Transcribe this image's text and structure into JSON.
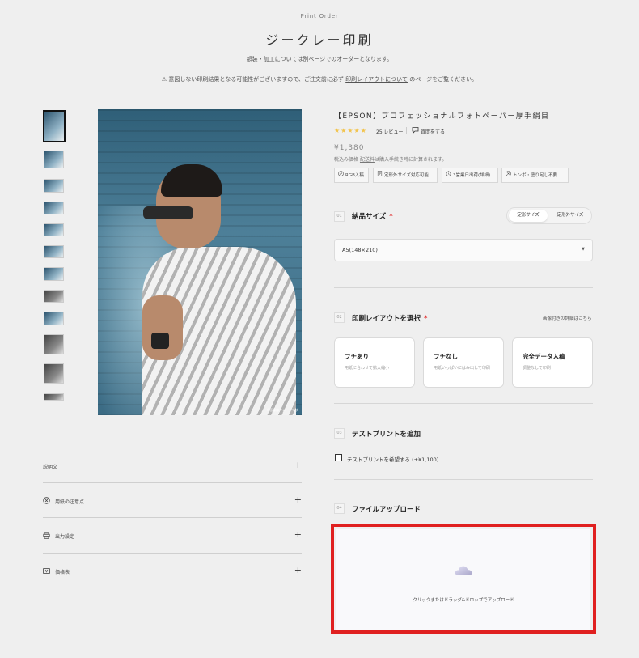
{
  "header": {
    "eyebrow": "Print Order",
    "title": "ジークレー印刷",
    "note1_link1": "額装",
    "note1_sep": "・",
    "note1_link2": "加工",
    "note1_rest": "については別ページでのオーダーとなります。",
    "note2_prefix": "⚠ 意図しない印刷結果となる可能性がございますので、ご注文前に必ず",
    "note2_link": "印刷レイアウトについて",
    "note2_suffix": "のページをご覧ください。"
  },
  "gallery": {
    "credit": "※画像はイメージです"
  },
  "accordion": [
    {
      "label": "説明文",
      "icon": "none"
    },
    {
      "label": "用紙の注意点",
      "icon": "x-circle-icon"
    },
    {
      "label": "出力設定",
      "icon": "printer-icon"
    },
    {
      "label": "価格表",
      "icon": "yen-card-icon"
    }
  ],
  "product": {
    "title": "【EPSON】プロフェッショナルフォトペーパー厚手絹目",
    "stars": "★★★★★",
    "reviews": "25 レビュー",
    "ask": "質問をする",
    "price": "¥1,380",
    "tax_note_prefix": "税込み価格",
    "tax_note_link": "配送料",
    "tax_note_suffix": "は購入手続き時に計算されます。",
    "badges": [
      {
        "icon": "check-circle-icon",
        "label": "RGB入稿"
      },
      {
        "icon": "document-icon",
        "label": "定形外サイズ対応可能"
      },
      {
        "icon": "timer-icon",
        "label": "3営業日出荷(詳細)"
      },
      {
        "icon": "x-circle-icon",
        "label": "トンボ・塗り足し不要"
      }
    ]
  },
  "steps": {
    "s1": {
      "num": "01",
      "label": "納品サイズ",
      "required": "*",
      "toggle": [
        "定形サイズ",
        "定形外サイズ"
      ],
      "select_value": "A5(148×210)",
      "caret": "▼"
    },
    "s2": {
      "num": "02",
      "label": "印刷レイアウトを選択",
      "required": "*",
      "link": "画像付きの詳細はこちら",
      "cards": [
        {
          "title": "フチあり",
          "desc": "用紙に合わせて拡大縮小"
        },
        {
          "title": "フチなし",
          "desc": "用紙いっぱいにはみ出して印刷"
        },
        {
          "title": "完全データ入稿",
          "desc": "調整なしで印刷"
        }
      ]
    },
    "s3": {
      "num": "03",
      "label": "テストプリントを追加",
      "checkbox_label": "テストプリントを希望する (+¥1,100)"
    },
    "s4": {
      "num": "04",
      "label": "ファイルアップロード",
      "upload_text": "クリックまたはドラッグ&ドロップでアップロード",
      "upload_icon": "cloud-icon"
    }
  }
}
